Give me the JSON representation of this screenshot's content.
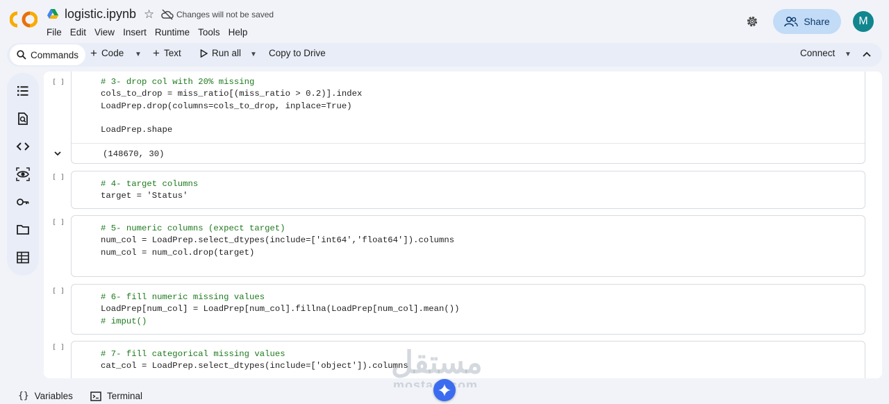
{
  "header": {
    "title": "logistic.ipynb",
    "unsaved_text": "Changes will not be saved",
    "share_label": "Share",
    "avatar_letter": "M",
    "menu": [
      "File",
      "Edit",
      "View",
      "Insert",
      "Runtime",
      "Tools",
      "Help"
    ]
  },
  "toolbar": {
    "commands": "Commands",
    "code": "Code",
    "text": "Text",
    "run_all": "Run all",
    "copy_to_drive": "Copy to Drive",
    "connect": "Connect"
  },
  "rail_icons": [
    "table-of-contents-icon",
    "find-icon",
    "code-snippets-icon",
    "variables-inspector-icon",
    "secrets-key-icon",
    "files-folder-icon",
    "data-table-icon"
  ],
  "cells": [
    {
      "bracket": "[ ]",
      "lines": [
        "# 3- drop col with 20% missing",
        "cols_to_drop = miss_ratio[(miss_ratio > 0.2)].index",
        "LoadPrep.drop(columns=cols_to_drop, inplace=True)",
        "",
        "LoadPrep.shape"
      ],
      "output": "(148670, 30)"
    },
    {
      "bracket": "[ ]",
      "lines": [
        "# 4- target columns",
        "target = 'Status'"
      ]
    },
    {
      "bracket": "[ ]",
      "lines": [
        "# 5- numeric columns (expect target)",
        "num_col = LoadPrep.select_dtypes(include=['int64','float64']).columns",
        "num_col = num_col.drop(target)"
      ]
    },
    {
      "bracket": "[ ]",
      "lines": [
        "# 6- fill numeric missing values",
        "LoadPrep[num_col] = LoadPrep[num_col].fillna(LoadPrep[num_col].mean())",
        "# imput()"
      ]
    },
    {
      "bracket": "[ ]",
      "lines": [
        "# 7- fill categorical missing values",
        "cat_col = LoadPrep.select_dtypes(include=['object']).columns"
      ]
    }
  ],
  "statusbar": {
    "variables": "Variables",
    "terminal": "Terminal"
  },
  "watermark": {
    "main": "مستقل",
    "sub": "mostaql.com"
  }
}
